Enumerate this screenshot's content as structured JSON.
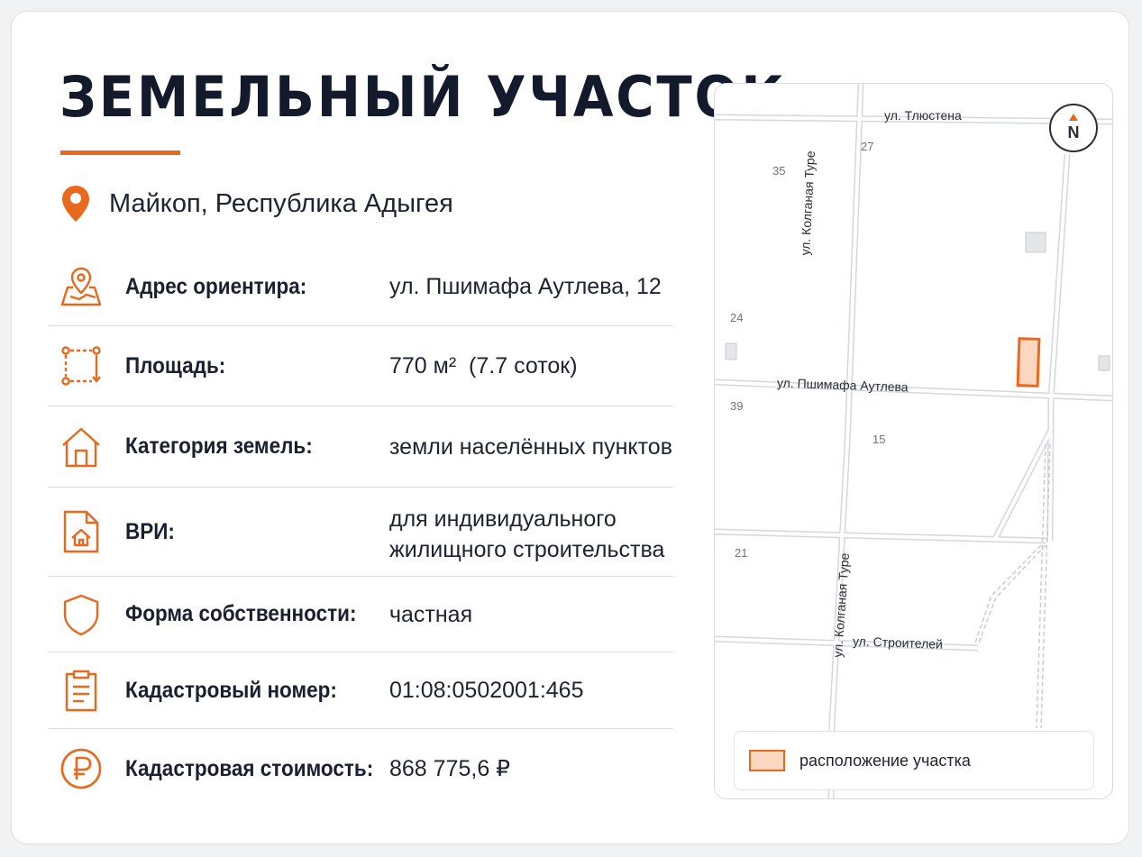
{
  "title": "ЗЕМЕЛЬНЫЙ УЧАСТОК",
  "location": "Майкоп, Республика Адыгея",
  "colors": {
    "accent": "#e8691d",
    "title": "#121a2b",
    "plot_fill": "#fbd7c0"
  },
  "rows": [
    {
      "icon": "map-pin-map-icon",
      "label": "Адрес ориентира:",
      "value": "ул. Пшимафа Аутлева, 12",
      "value2": ""
    },
    {
      "icon": "area-measure-icon",
      "label": "Площадь:",
      "value": "770 м²  (7.7 соток)",
      "value2": ""
    },
    {
      "icon": "house-icon",
      "label": "Категория земель:",
      "value": "земли населённых пунктов",
      "value2": ""
    },
    {
      "icon": "document-house-icon",
      "label": "ВРИ:",
      "value": "для индивидуального",
      "value2": "жилищного строительства"
    },
    {
      "icon": "shield-icon",
      "label": "Форма собственности:",
      "value": "частная",
      "value2": ""
    },
    {
      "icon": "clipboard-icon",
      "label": "Кадастровый номер:",
      "value": "01:08:0502001:465",
      "value2": ""
    },
    {
      "icon": "ruble-coin-icon",
      "label": "Кадастровая стоимость:",
      "value": "868 775,6 ₽",
      "value2": ""
    }
  ],
  "map": {
    "compass": "N",
    "streets": {
      "tlyustena": "ул. Тлюстена",
      "kolganaya_top": "ул. Колганая Туре",
      "pshimafa": "ул. Пшимафа Аутлева",
      "kolganaya_bottom": "ул. Колганая Туре",
      "stroiteley": "ул. Строителей"
    },
    "numbers": {
      "n27": "27",
      "n35": "35",
      "n24": "24",
      "n39": "39",
      "n15": "15",
      "n21": "21"
    },
    "legend": "расположение участка"
  }
}
